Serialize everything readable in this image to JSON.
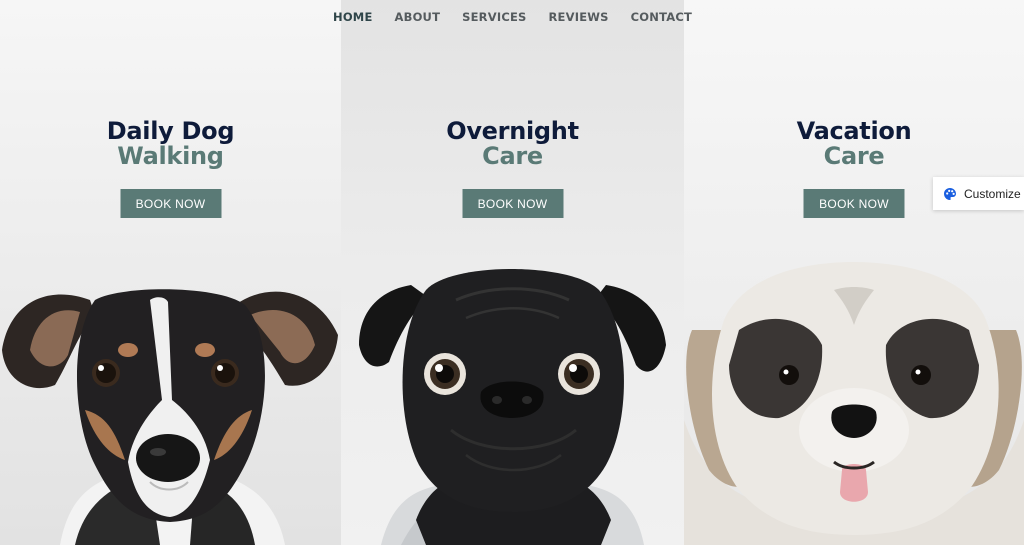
{
  "nav": {
    "items": [
      {
        "label": "HOME",
        "active": true
      },
      {
        "label": "ABOUT"
      },
      {
        "label": "SERVICES"
      },
      {
        "label": "REVIEWS"
      },
      {
        "label": "CONTACT"
      }
    ]
  },
  "panels": [
    {
      "title_line1": "Daily Dog",
      "title_line2": "Walking",
      "button": "BOOK NOW",
      "image": "terrier-dog-photo"
    },
    {
      "title_line1": "Overnight",
      "title_line2": "Care",
      "button": "BOOK NOW",
      "image": "black-pug-photo"
    },
    {
      "title_line1": "Vacation",
      "title_line2": "Care",
      "button": "BOOK NOW",
      "image": "shih-tzu-dog-photo"
    }
  ],
  "customize": {
    "label": "Customize",
    "icon": "palette-icon"
  },
  "colors": {
    "navy": "#0e1b3a",
    "sage": "#5a7a76",
    "nav_text": "#555b5e"
  }
}
